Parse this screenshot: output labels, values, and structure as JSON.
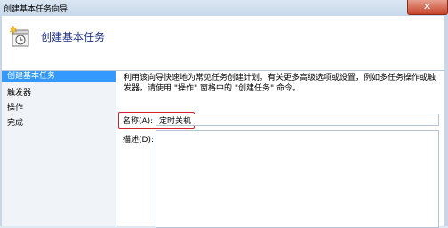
{
  "window": {
    "title": "创建基本任务向导",
    "close_label": "✕"
  },
  "header": {
    "icon": "task-scheduler-icon",
    "title": "创建基本任务"
  },
  "nav": {
    "items": [
      {
        "label": "创建基本任务",
        "active": true
      },
      {
        "label": "触发器",
        "active": false
      },
      {
        "label": "操作",
        "active": false
      },
      {
        "label": "完成",
        "active": false
      }
    ]
  },
  "main": {
    "description": "利用该向导快速地为常见任务创建计划。有关更多高级选项或设置，例如多任务操作或触发器，请使用 \"操作\" 窗格中的 \"创建任务\" 命令。",
    "name_label": "名称(A):",
    "name_value": "定时关机",
    "desc_label": "描述(D):",
    "desc_value": ""
  },
  "colors": {
    "accent": "#3399ff",
    "highlight_box": "#d2232a",
    "header_title": "#1e3287"
  }
}
